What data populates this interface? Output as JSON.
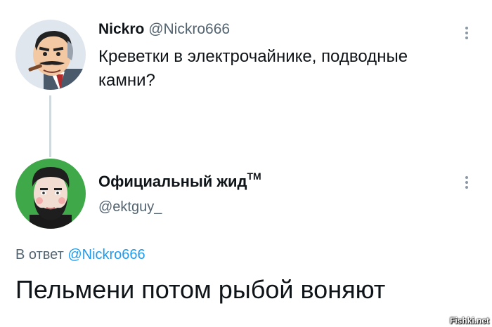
{
  "tweet1": {
    "name": "Nickro",
    "handle": "@Nickro666",
    "text": "Креветки в электрочайнике, подводные камни?"
  },
  "tweet2": {
    "name": "Официальный жид",
    "trademark": "TM",
    "handle": "@ektguy_",
    "reply_prefix": "В ответ",
    "reply_mention": "@Nickro666",
    "text": "Пельмени потом рыбой воняют"
  },
  "watermark": "Fishki.net",
  "colors": {
    "text": "#0f1419",
    "secondary": "#536471",
    "link": "#1d9bf0",
    "thread_line": "#cfd9de"
  },
  "icons": {
    "more": "more-vertical-icon"
  }
}
